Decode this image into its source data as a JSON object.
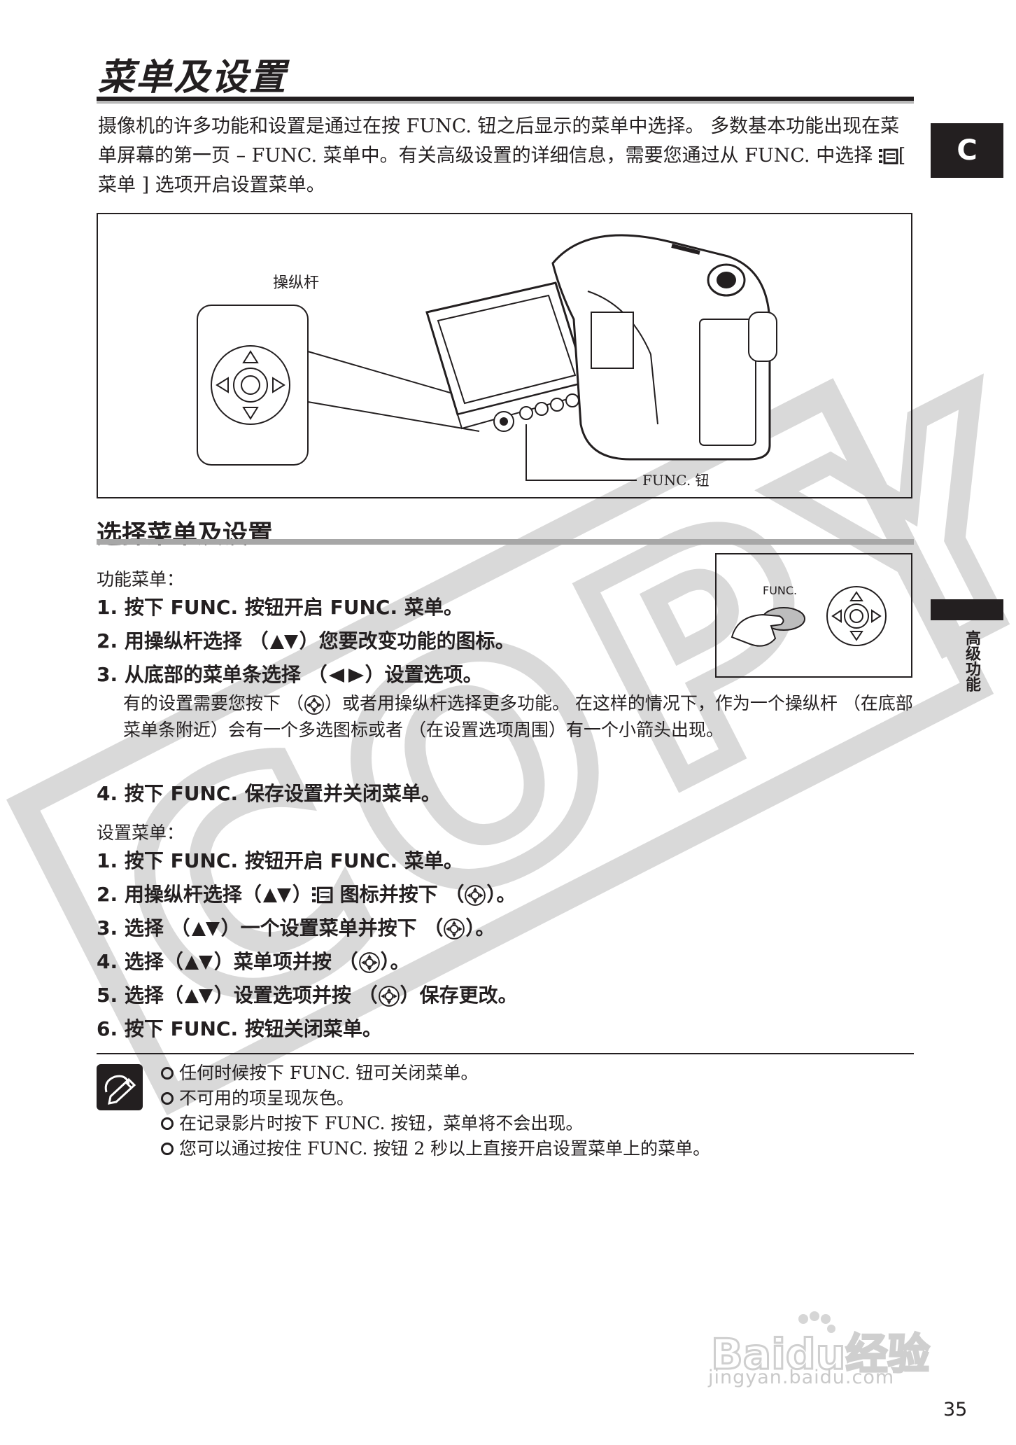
{
  "title": "菜单及设置",
  "intro": "摄像机的许多功能和设置是通过在按 FUNC. 钮之后显示的菜单中选择。 多数基本功能出现在菜单屏幕的第一页 – FUNC. 菜单中。有关高级设置的详细信息，需要您通过从 FUNC. 中选择",
  "intro_tail": "[ 菜单 ] 选项开启设置菜单。",
  "chapter_tab": "C",
  "side_label": "高级功能",
  "diagram": {
    "joystick_label": "操纵杆",
    "func_button_label": "FUNC. 钮"
  },
  "section_title": "选择菜单及设置",
  "func_menu": {
    "heading": "功能菜单：",
    "panel_label": "FUNC.",
    "steps": [
      {
        "num": "1.",
        "text": "按下 FUNC. 按钮开启 FUNC. 菜单。"
      },
      {
        "num": "2.",
        "pre": "用操纵杆选择 （",
        "post": "）您要改变功能的图标。"
      },
      {
        "num": "3.",
        "pre": "从底部的菜单条选择 （",
        "post": "）设置选项。"
      },
      {
        "num": "4.",
        "text": "按下 FUNC. 保存设置并关闭菜单。"
      }
    ],
    "step3_note_pre": "有的设置需要您按下 （",
    "step3_note_post": "）或者用操纵杆选择更多功能。 在这样的情况下，作为一个操纵杆 （在底部菜单条附近）会有一个多选图标或者 （在设置选项周围）有一个小箭头出现。"
  },
  "setup_menu": {
    "heading": "设置菜单：",
    "steps": [
      {
        "num": "1.",
        "text": "按下 FUNC. 按钮开启 FUNC. 菜单。"
      },
      {
        "num": "2.",
        "pre": "用操纵杆选择（",
        "mid": "）",
        "post": "图标并按下 （",
        "end": "）。"
      },
      {
        "num": "3.",
        "pre": "选择 （",
        "mid": "）一个设置菜单并按下 （",
        "end": "）。"
      },
      {
        "num": "4.",
        "pre": "选择（",
        "mid": "）菜单项并按 （",
        "end": "）。"
      },
      {
        "num": "5.",
        "pre": "选择（",
        "mid": "）设置选项并按 （",
        "end": "）保存更改。"
      },
      {
        "num": "6.",
        "text": "按下 FUNC. 按钮关闭菜单。"
      }
    ]
  },
  "notes": [
    "任何时候按下 FUNC. 钮可关闭菜单。",
    "不可用的项呈现灰色。",
    "在记录影片时按下 FUNC. 按钮，菜单将不会出现。",
    "您可以通过按住 FUNC. 按钮 2 秒以上直接开启设置菜单上的菜单。"
  ],
  "watermark": "COPY",
  "baidu": {
    "logo": "Baidu",
    "brand": "经验",
    "url": "jingyan.baidu.com"
  },
  "page_number": "35"
}
